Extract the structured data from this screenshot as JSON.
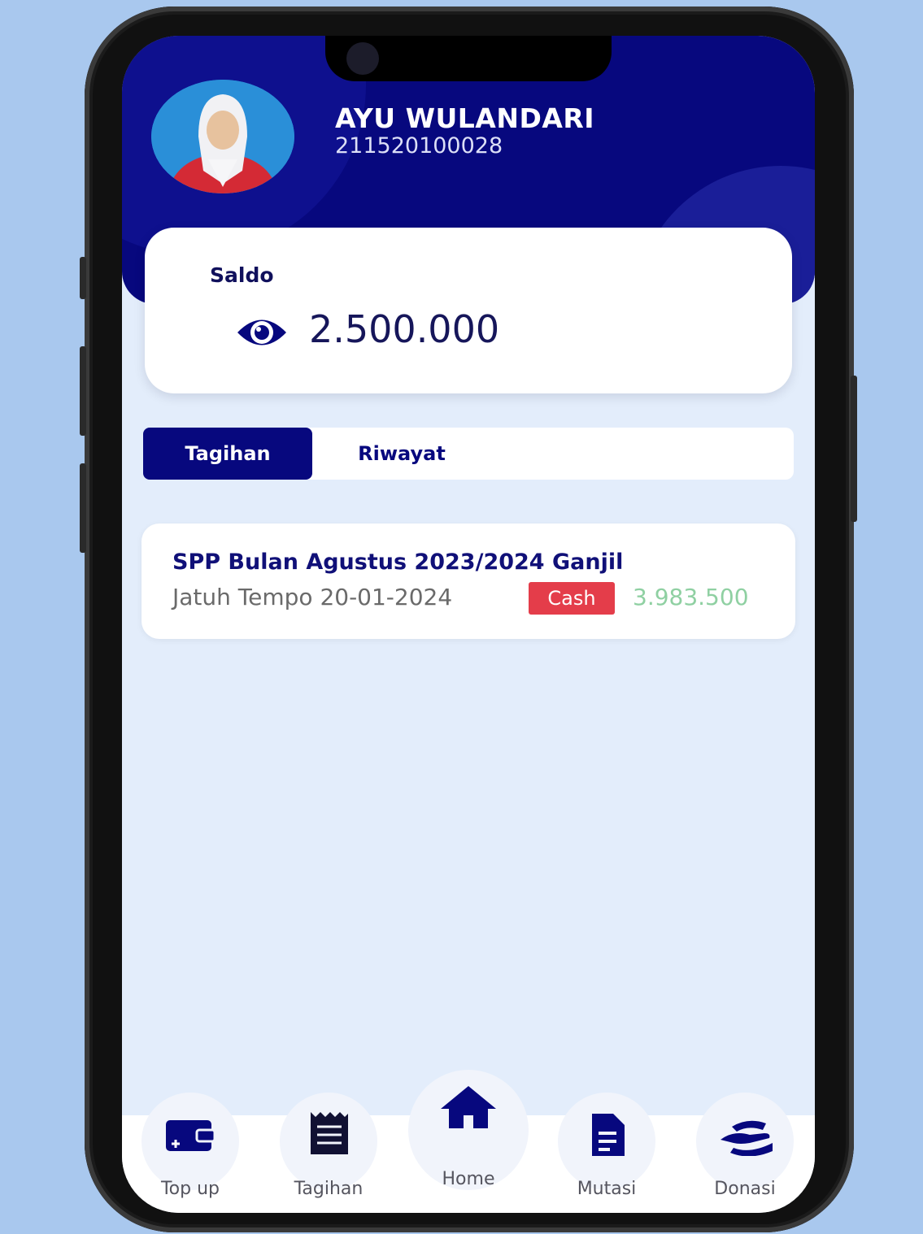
{
  "user": {
    "name": "AYU WULANDARI",
    "id": "211520100028"
  },
  "balance": {
    "label": "Saldo",
    "value": "2.500.000"
  },
  "tabs": [
    {
      "label": "Tagihan",
      "active": true
    },
    {
      "label": "Riwayat",
      "active": false
    }
  ],
  "bills": [
    {
      "title": "SPP Bulan Agustus 2023/2024 Ganjil",
      "due": "Jatuh Tempo 20-01-2024",
      "method": "Cash",
      "amount": "3.983.500"
    }
  ],
  "bottom_nav": [
    {
      "label": "Top up",
      "icon": "wallet-icon"
    },
    {
      "label": "Tagihan",
      "icon": "receipt-icon"
    },
    {
      "label": "Home",
      "icon": "home-icon",
      "active": true
    },
    {
      "label": "Mutasi",
      "icon": "document-icon"
    },
    {
      "label": "Donasi",
      "icon": "hand-donate-icon"
    }
  ],
  "colors": {
    "primary": "#07087e",
    "background": "#e3edfb",
    "badge": "#e43d4a",
    "amount": "#8fd0a2"
  }
}
